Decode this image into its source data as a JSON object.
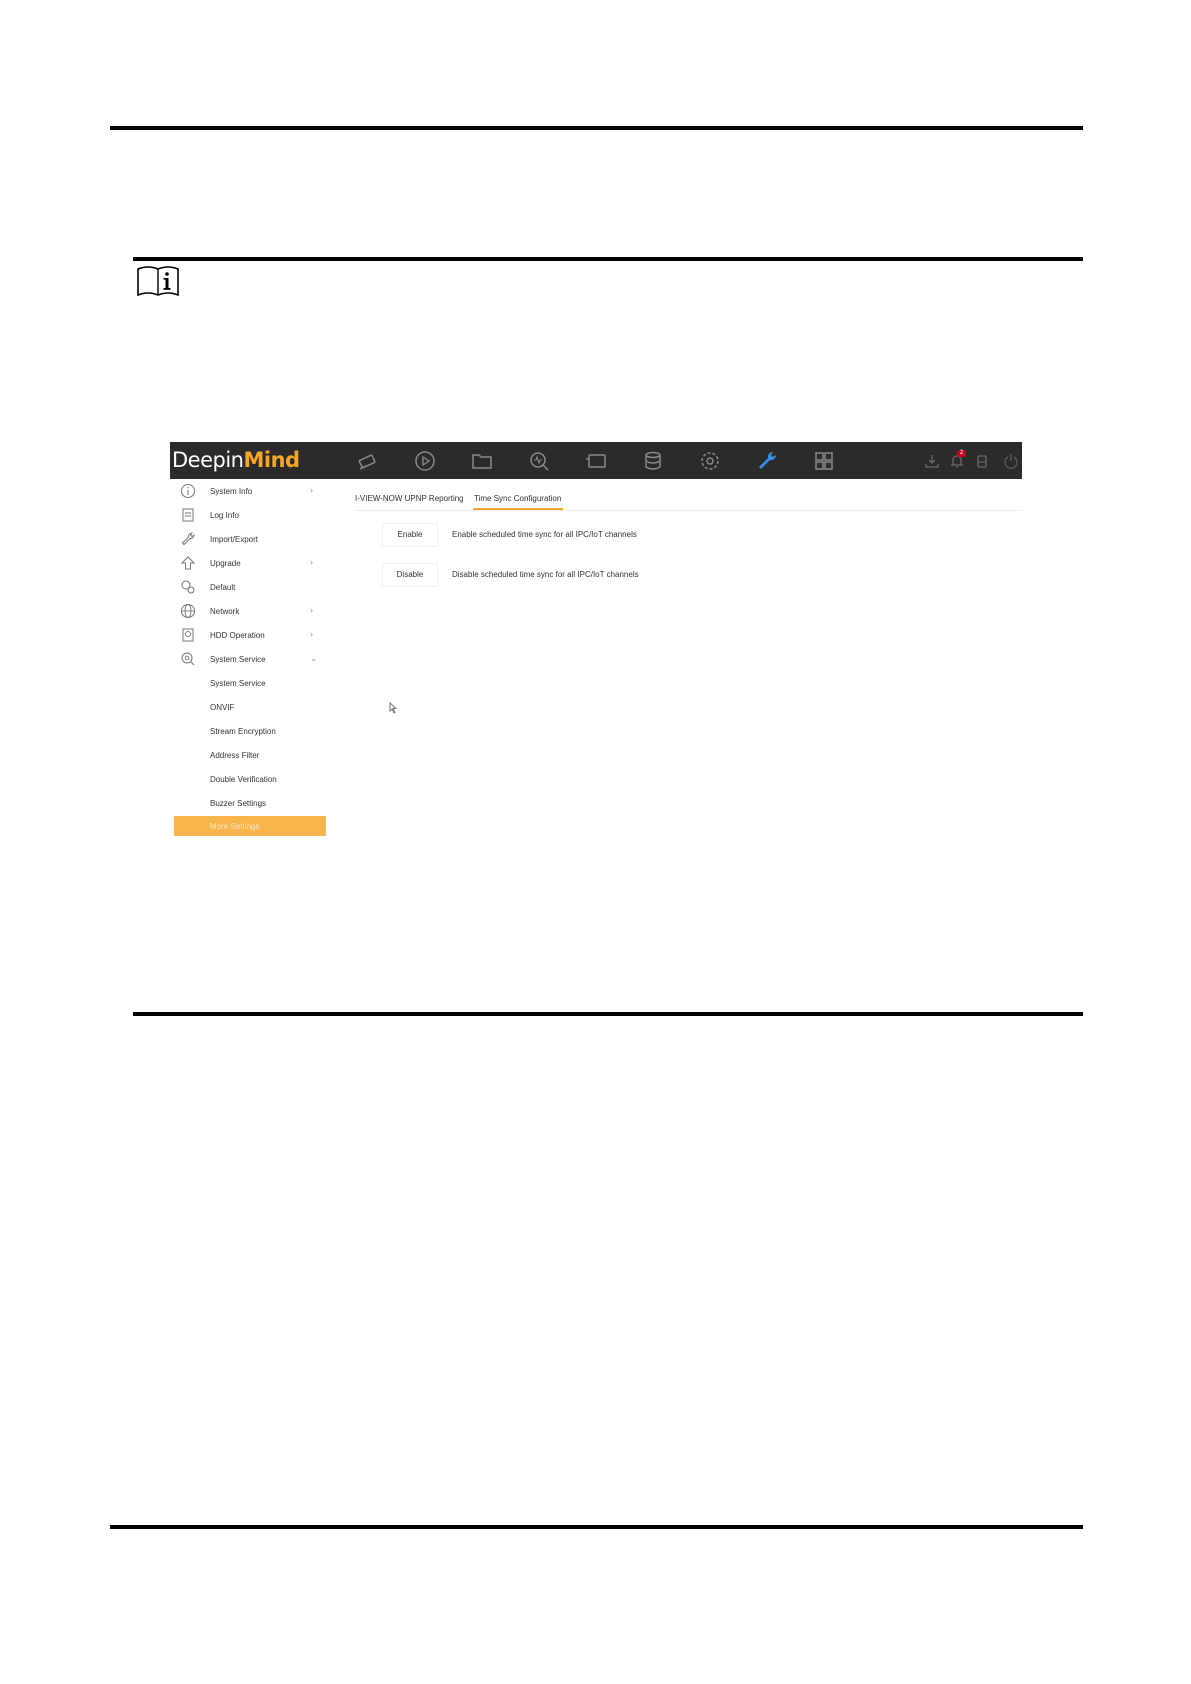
{
  "app": {
    "logo_regular": "Deepin",
    "logo_bold": "Mind",
    "nav_icons": [
      "camera-icon",
      "playback-icon",
      "folder-icon",
      "search-icon",
      "smart-icon",
      "storage-icon",
      "settings-icon",
      "maintenance-icon",
      "grid-icon"
    ],
    "active_nav": "maintenance-icon",
    "utility_icons": [
      "download-icon",
      "alarm-icon",
      "storage-status-icon",
      "power-icon"
    ],
    "alarm_count": "2"
  },
  "sidebar": {
    "items": [
      {
        "label": "System Info",
        "icon": "info-icon",
        "chevron": "›"
      },
      {
        "label": "Log Info",
        "icon": "log-icon",
        "chevron": ""
      },
      {
        "label": "Import/Export",
        "icon": "wrench-icon",
        "chevron": ""
      },
      {
        "label": "Upgrade",
        "icon": "upgrade-icon",
        "chevron": "›"
      },
      {
        "label": "Default",
        "icon": "default-icon",
        "chevron": ""
      },
      {
        "label": "Network",
        "icon": "globe-icon",
        "chevron": "›"
      },
      {
        "label": "HDD Operation",
        "icon": "hdd-icon",
        "chevron": "›"
      },
      {
        "label": "System Service",
        "icon": "service-icon",
        "chevron": "⌄"
      }
    ],
    "subitems": [
      {
        "label": "System Service"
      },
      {
        "label": "ONVIF"
      },
      {
        "label": "Stream Encryption"
      },
      {
        "label": "Address Filter"
      },
      {
        "label": "Double Verification"
      },
      {
        "label": "Buzzer Settings"
      },
      {
        "label": "More Settings"
      }
    ],
    "selected": "More Settings"
  },
  "main": {
    "tabs": [
      {
        "label": "I-VIEW-NOW UPNP Reporting"
      },
      {
        "label": "Time Sync Configuration"
      }
    ],
    "active_tab": "Time Sync Configuration",
    "actions": [
      {
        "button": "Enable",
        "description": "Enable scheduled time sync for all IPC/IoT channels"
      },
      {
        "button": "Disable",
        "description": "Disable scheduled time sync for all IPC/IoT channels"
      }
    ]
  },
  "colors": {
    "accent": "#f5a623",
    "topbar": "#2b2b2b",
    "selected_bg": "#f8b44c",
    "active_icon": "#3a8ee6",
    "alarm": "#d0021b"
  }
}
